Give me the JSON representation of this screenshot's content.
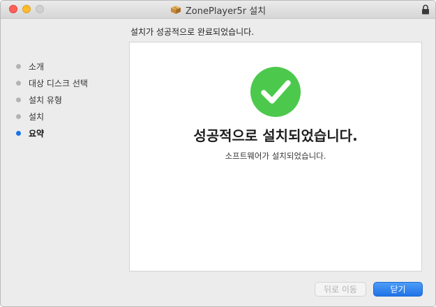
{
  "window": {
    "title": "ZonePlayer5r 설치"
  },
  "header": {
    "text": "설치가 성공적으로 완료되었습니다."
  },
  "sidebar": {
    "steps": [
      {
        "label": "소개"
      },
      {
        "label": "대상 디스크 선택"
      },
      {
        "label": "설치 유형"
      },
      {
        "label": "설치"
      },
      {
        "label": "요약"
      }
    ]
  },
  "main": {
    "title": "성공적으로 설치되었습니다.",
    "subtitle": "소프트웨어가 설치되었습니다."
  },
  "buttons": {
    "back": "뒤로 이동",
    "close": "닫기"
  },
  "colors": {
    "success": "#4cc94c",
    "accent": "#1a73e8"
  }
}
